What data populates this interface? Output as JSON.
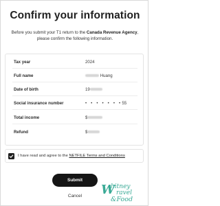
{
  "page": {
    "title": "Confirm your information",
    "intro_prefix": "Before you submit your T1 return to the ",
    "intro_bold": "Canada Revenue Agency",
    "intro_suffix": ", please confirm the following information."
  },
  "summary": {
    "rows": [
      {
        "label": "Tax year",
        "value": "2024"
      },
      {
        "label": "Full name",
        "value": "Huang"
      },
      {
        "label": "Date of birth",
        "value": "19"
      },
      {
        "label": "Social insurance number",
        "value_masked": "• • • • • • •",
        "value_suffix": "55"
      },
      {
        "label": "Total income",
        "value": "$"
      },
      {
        "label": "Refund",
        "value": "$"
      }
    ]
  },
  "agreement": {
    "checked": true,
    "text_prefix": "I have read and agree to the ",
    "link_text": "NETFILE Terms and Conditions"
  },
  "actions": {
    "submit_label": "Submit",
    "cancel_label": "Cancel"
  },
  "watermark": {
    "line1": "hitney",
    "line2": "ravel",
    "line3": "&Food",
    "initial": "W"
  },
  "colors": {
    "primary_button": "#151515",
    "watermark": "#2aa38e"
  }
}
